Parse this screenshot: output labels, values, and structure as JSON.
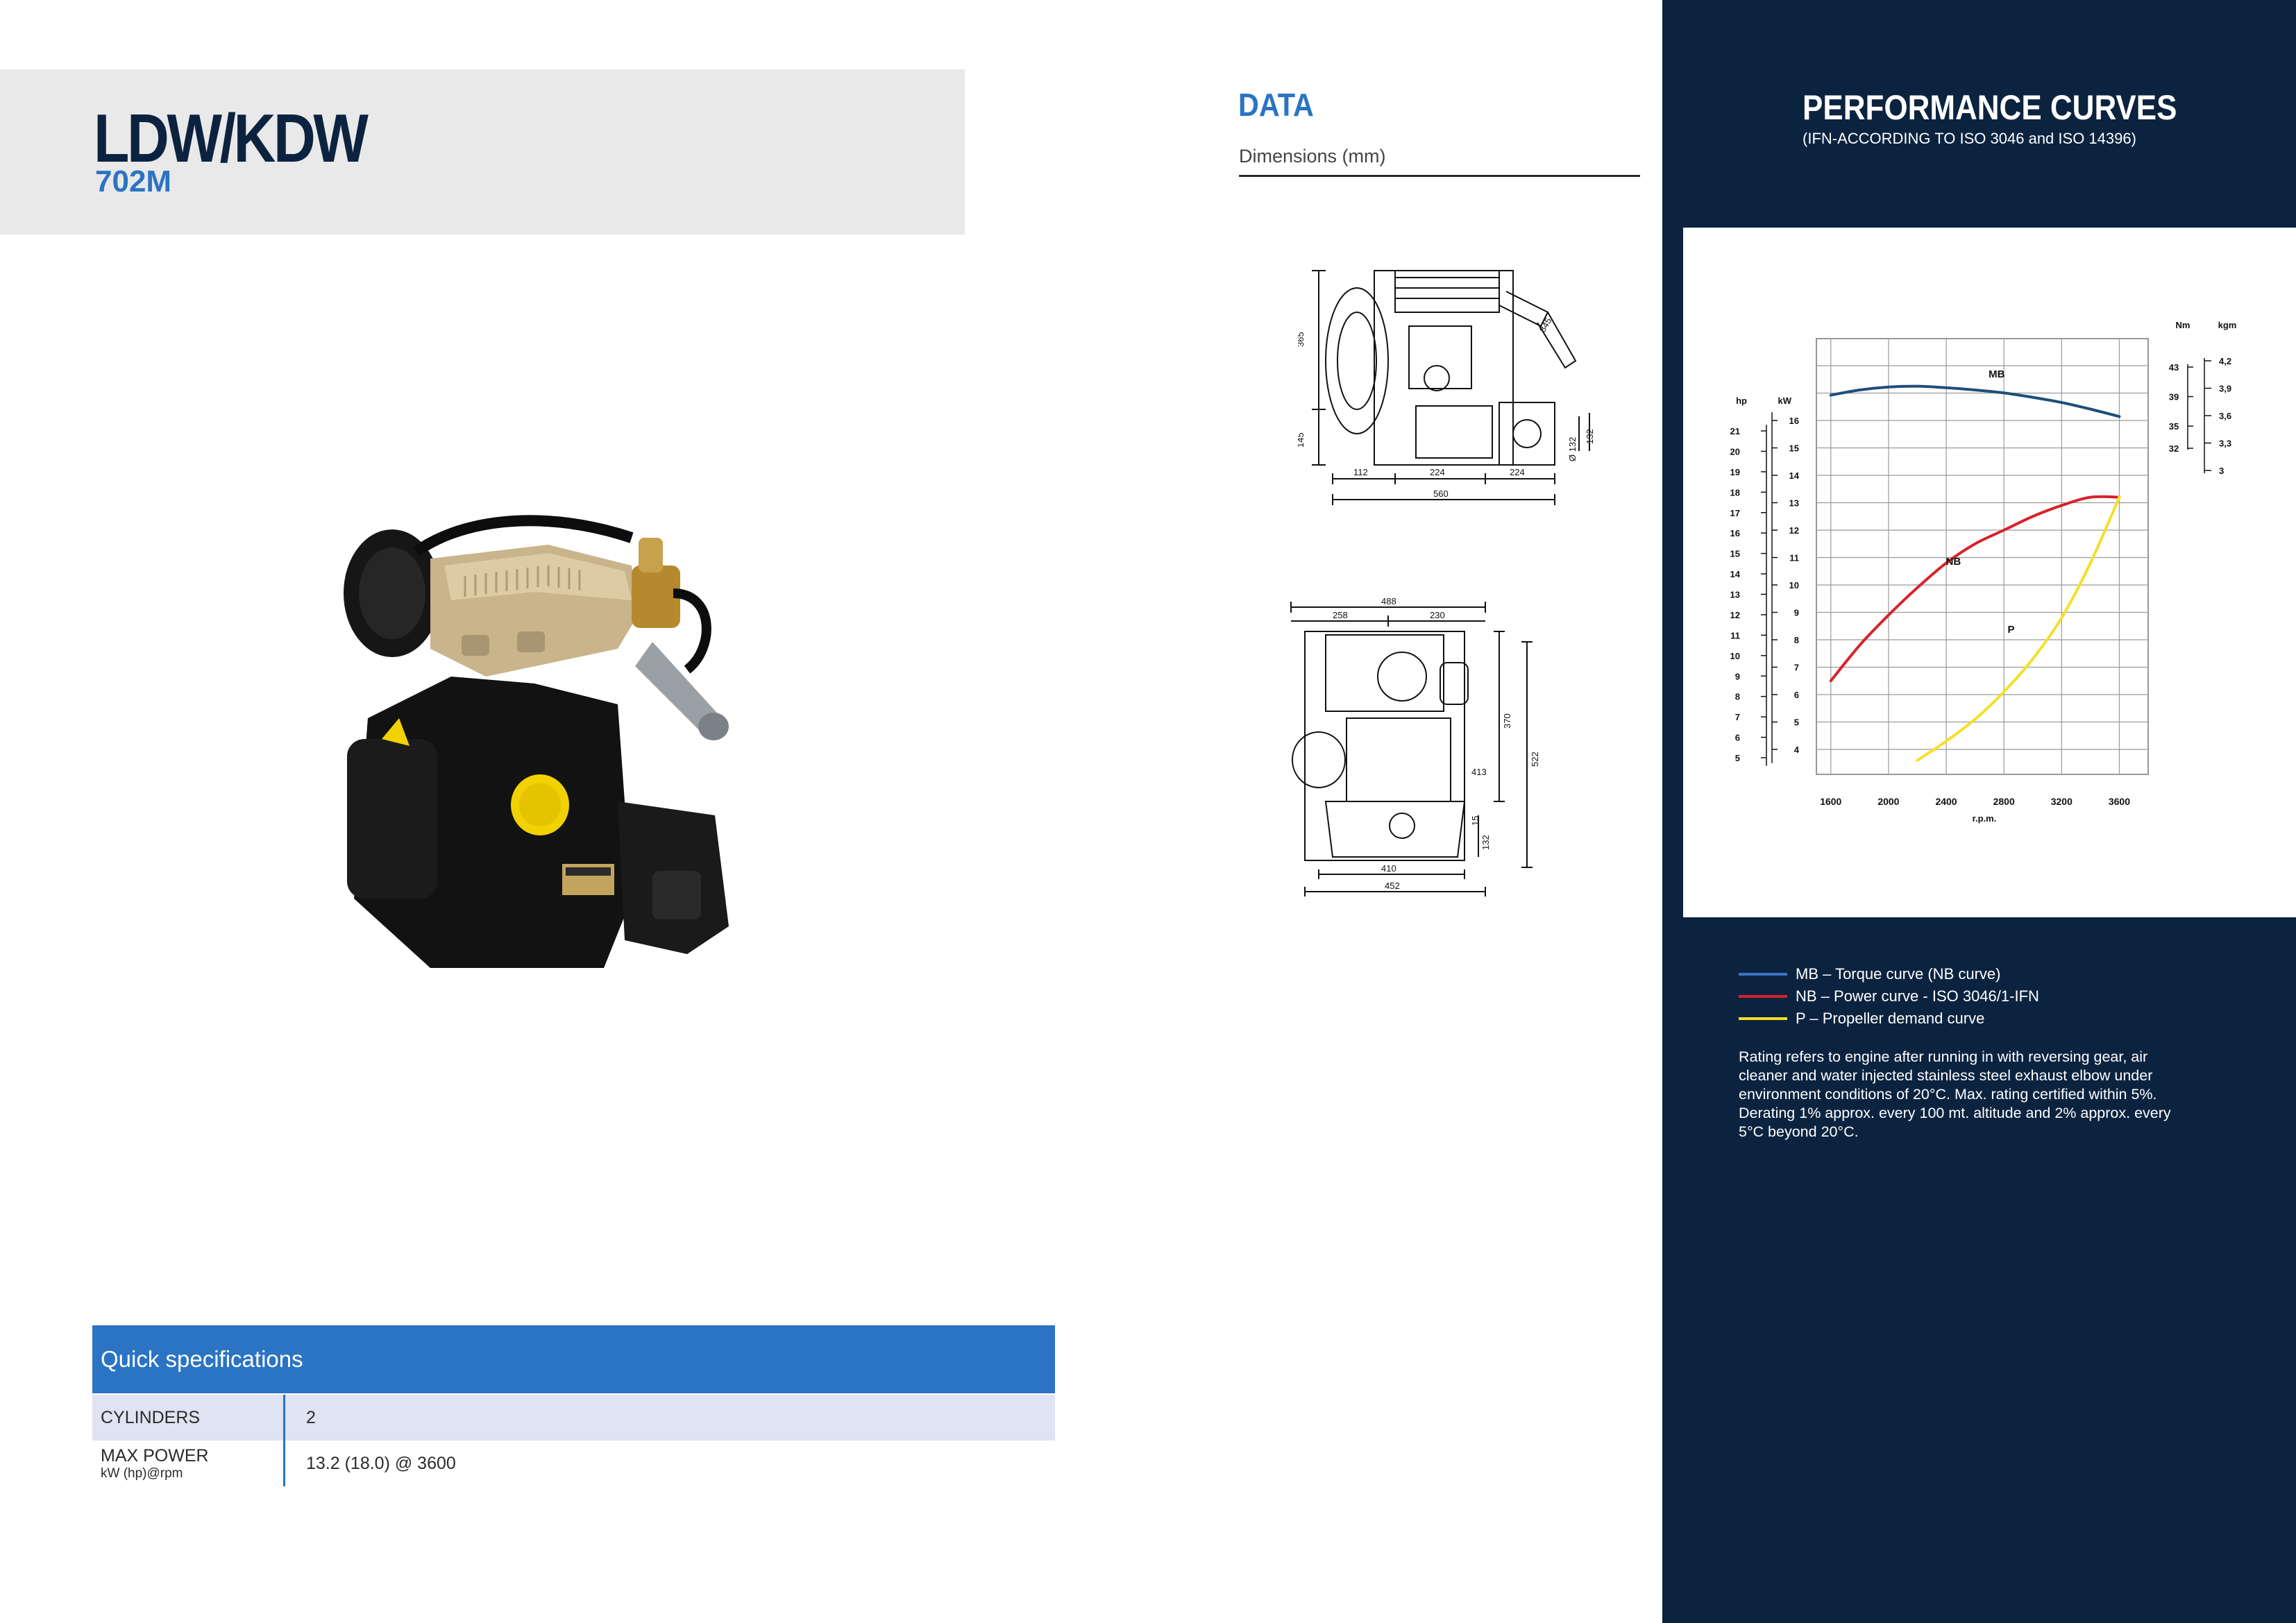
{
  "header": {
    "model": "LDW/KDW",
    "variant": "702M"
  },
  "data_section": {
    "title": "DATA",
    "subtitle": "Dimensions (mm)"
  },
  "drawings": {
    "side_view_dims": [
      "365",
      "145",
      "112",
      "224",
      "224",
      "560",
      "845",
      "132",
      "Ø 132"
    ],
    "front_view_dims": [
      "488",
      "258",
      "230",
      "370",
      "522",
      "410",
      "452",
      "413",
      "132",
      "15"
    ]
  },
  "specs": {
    "title": "Quick specifications",
    "rows": [
      {
        "label": "CYLINDERS",
        "unit": "",
        "value": "2"
      },
      {
        "label": "MAX POWER",
        "unit": "kW (hp)@rpm",
        "value": "13.2 (18.0) @ 3600"
      }
    ]
  },
  "performance": {
    "title": "PERFORMANCE CURVES",
    "subtitle": "(IFN-ACCORDING TO ISO 3046 and ISO 14396)"
  },
  "chart_data": {
    "type": "line",
    "xlabel": "r.p.m.",
    "x_ticks": [
      1600,
      2000,
      2400,
      2800,
      3200,
      3600
    ],
    "xlim": [
      1600,
      3600
    ],
    "axes": {
      "kW": {
        "label": "kW",
        "ticks": [
          4,
          5,
          6,
          7,
          8,
          9,
          10,
          11,
          12,
          13,
          14,
          15,
          16
        ]
      },
      "hp": {
        "label": "hp",
        "ticks": [
          5,
          6,
          7,
          8,
          9,
          10,
          11,
          12,
          13,
          14,
          15,
          16,
          17,
          18,
          19,
          20,
          21
        ]
      },
      "Nm": {
        "label": "Nm",
        "ticks": [
          32,
          35,
          39,
          43
        ]
      },
      "kgm": {
        "label": "kgm",
        "ticks": [
          "3",
          "3,3",
          "3,6",
          "3,9",
          "4,2"
        ]
      }
    },
    "series": [
      {
        "name": "MB",
        "axis": "Nm",
        "color": "#1f4e79",
        "x": [
          1600,
          1800,
          2000,
          2200,
          2400,
          2600,
          2800,
          3000,
          3200,
          3400,
          3600
        ],
        "y": [
          39.2,
          39.9,
          40.3,
          40.4,
          40.2,
          39.9,
          39.5,
          38.9,
          38.2,
          37.3,
          36.3
        ]
      },
      {
        "name": "NB",
        "axis": "kW",
        "color": "#d6232a",
        "x": [
          1600,
          1800,
          2000,
          2200,
          2400,
          2600,
          2800,
          3000,
          3200,
          3400,
          3600
        ],
        "y": [
          6.5,
          7.8,
          8.9,
          9.9,
          10.8,
          11.5,
          12.0,
          12.5,
          12.9,
          13.2,
          13.2
        ]
      },
      {
        "name": "P",
        "axis": "kW",
        "color": "#f5e02a",
        "x": [
          2200,
          2400,
          2600,
          2800,
          3000,
          3200,
          3400,
          3600
        ],
        "y": [
          3.6,
          4.3,
          5.1,
          6.1,
          7.3,
          8.8,
          10.8,
          13.2
        ]
      }
    ],
    "curve_labels": [
      "MB",
      "NB",
      "P"
    ]
  },
  "legend": [
    {
      "label": "MB – Torque curve (NB curve)",
      "color": "#3d72c2"
    },
    {
      "label": "NB – Power curve - ISO 3046/1-IFN",
      "color": "#d6232a"
    },
    {
      "label": "P – Propeller demand curve",
      "color": "#f5e02a"
    }
  ],
  "note": "Rating refers to engine after running in with reversing gear, air cleaner and water injected stainless steel exhaust elbow under environment conditions of 20°C. Max. rating certified within 5%. Derating 1% approx. every 100 mt. altitude and 2% approx. every 5°C beyond 20°C."
}
